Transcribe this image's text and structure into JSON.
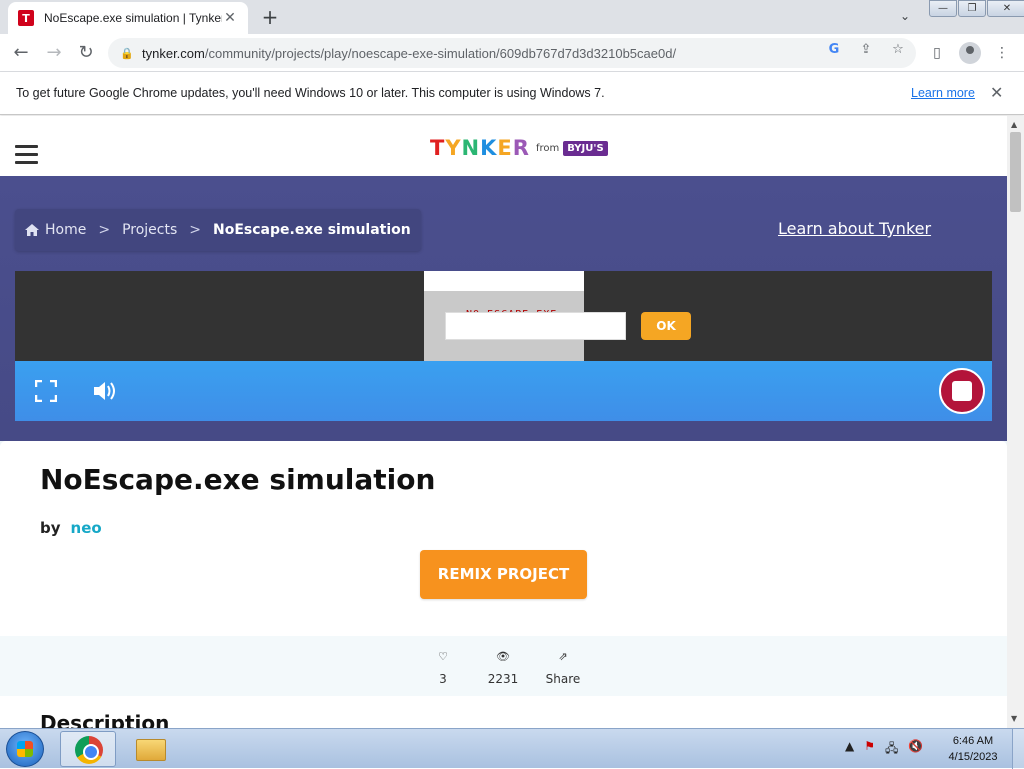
{
  "browser": {
    "tab_title": "NoEscape.exe simulation | Tynker",
    "favicon_letter": "T",
    "url_host": "tynker.com",
    "url_path": "/community/projects/play/noescape-exe-simulation/609db767d7d3d3210b5cae0d/"
  },
  "infobar": {
    "message": "To get future Google Chrome updates, you'll need Windows 10 or later. This computer is using Windows 7.",
    "link": "Learn more"
  },
  "site": {
    "logo_text": "TYNKER",
    "logo_from": "from",
    "logo_partner": "BYJU'S",
    "breadcrumb": {
      "home": "Home",
      "sep": ">",
      "projects": "Projects",
      "current": "NoEscape.exe simulation"
    },
    "learn_link": "Learn about Tynker"
  },
  "player": {
    "game_title": "NO ESCAPE.EXE",
    "ok_label": "OK"
  },
  "project": {
    "title": "NoEscape.exe simulation",
    "by_label": "by",
    "author": "neo",
    "remix_label": "REMIX PROJECT",
    "likes": "3",
    "views": "2231",
    "share_label": "Share",
    "description_heading": "Description"
  },
  "taskbar": {
    "time": "6:46 AM",
    "date": "4/15/2023"
  },
  "colors": {
    "hero": "#4b4f8e",
    "remix": "#f7921e",
    "author": "#16a8c7",
    "player_bar": "#3aa0f0",
    "stop": "#b3143a"
  }
}
